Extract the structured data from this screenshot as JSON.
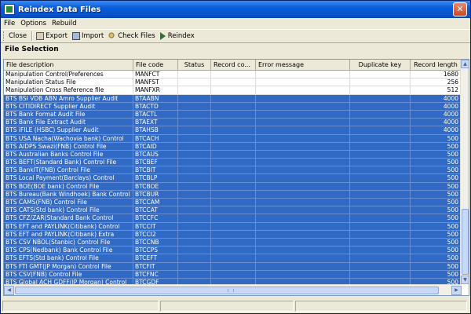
{
  "window": {
    "title": "Reindex Data Files"
  },
  "menu": [
    "File",
    "Options",
    "Rebuild"
  ],
  "toolbar": {
    "close": "Close",
    "export": "Export",
    "import": "Import",
    "check_files": "Check Files",
    "reindex": "Reindex"
  },
  "section": {
    "title": "File Selection"
  },
  "columns": [
    "File description",
    "File code",
    "Status",
    "Record co...",
    "Error message",
    "Duplicate key",
    "Record length"
  ],
  "rows": [
    [
      "Manipulation Control/Preferences",
      "MANFCT",
      "",
      "",
      "",
      "",
      "1680"
    ],
    [
      "Manipulation Status File",
      "MANFST",
      "",
      "",
      "",
      "",
      "256"
    ],
    [
      "Manipulation Cross Reference file",
      "MANFXR",
      "",
      "",
      "",
      "",
      "512"
    ],
    [
      "BTS BSI VDB ABN Amro Supplier Audit",
      "BTAABN",
      "",
      "",
      "",
      "",
      "4000"
    ],
    [
      "BTS CITIDIRECT Supplier Audit",
      "BTACTD",
      "",
      "",
      "",
      "",
      "4000"
    ],
    [
      "BTS Bank Format Audit File",
      "BTACTL",
      "",
      "",
      "",
      "",
      "4000"
    ],
    [
      "BTS Bank File Extract Audit",
      "BTAEXT",
      "",
      "",
      "",
      "",
      "4000"
    ],
    [
      "BTS iFILE (HSBC) Supplier Audit",
      "BTAHSB",
      "",
      "",
      "",
      "",
      "4000"
    ],
    [
      "BTS USA Nacha(Wachovia bank) Control",
      "BTCACH",
      "",
      "",
      "",
      "",
      "500"
    ],
    [
      "BTS AIDPS Swazi(FNB) Control File",
      "BTCAID",
      "",
      "",
      "",
      "",
      "500"
    ],
    [
      "BTS Australian Banks Control File",
      "BTCAUS",
      "",
      "",
      "",
      "",
      "500"
    ],
    [
      "BTS BEFT(Standard Bank) Control File",
      "BTCBEF",
      "",
      "",
      "",
      "",
      "500"
    ],
    [
      "BTS BankIT(FNB) Control File",
      "BTCBIT",
      "",
      "",
      "",
      "",
      "500"
    ],
    [
      "BTS Local Payment(Barclays) Control",
      "BTCBLP",
      "",
      "",
      "",
      "",
      "500"
    ],
    [
      "BTS BOE(BOE bank) Control File",
      "BTCBOE",
      "",
      "",
      "",
      "",
      "500"
    ],
    [
      "BTS Bureau(Bank Windhoek) Bank Control",
      "BTCBUR",
      "",
      "",
      "",
      "",
      "500"
    ],
    [
      "BTS CAMS(FNB) Control File",
      "BTCCAM",
      "",
      "",
      "",
      "",
      "500"
    ],
    [
      "BTS CATS(Std bank) Control File",
      "BTCCAT",
      "",
      "",
      "",
      "",
      "500"
    ],
    [
      "BTS CFZ/ZAR(Standard Bank Control",
      "BTCCFC",
      "",
      "",
      "",
      "",
      "500"
    ],
    [
      "BTS EFT and PAYLINK(Citibank) Control",
      "BTCCIT",
      "",
      "",
      "",
      "",
      "500"
    ],
    [
      "BTS EFT and PAYLINK(Citibank) Extra",
      "BTCCI2",
      "",
      "",
      "",
      "",
      "500"
    ],
    [
      "BTS CSV NBOL(Stanbic) Control File",
      "BTCCNB",
      "",
      "",
      "",
      "",
      "500"
    ],
    [
      "BTS CPS(Nedbank) Bank Control File",
      "BTCCPS",
      "",
      "",
      "",
      "",
      "500"
    ],
    [
      "BTS EFTS(Std bank) Control File",
      "BTCEFT",
      "",
      "",
      "",
      "",
      "500"
    ],
    [
      "BTS FTI GMT(JP Morgan) Control File",
      "BTCFIT",
      "",
      "",
      "",
      "",
      "500"
    ],
    [
      "BTS CSV(FNB) Control File",
      "BTCFNC",
      "",
      "",
      "",
      "",
      "500"
    ],
    [
      "BTS Global ACH GDFF(JP Morgan) Control",
      "BTCGDF",
      "",
      "",
      "",
      "",
      "500"
    ]
  ],
  "selected_from_index": 3,
  "colors": {
    "selection": "#316ac5",
    "titlebar": "#0a5cd8"
  }
}
